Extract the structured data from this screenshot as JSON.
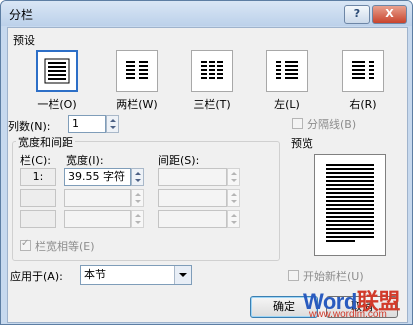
{
  "window": {
    "title": "分栏",
    "help_label": "?",
    "close_label": "X"
  },
  "presets": {
    "group_label": "预设",
    "items": [
      {
        "label": "一栏(O)",
        "columns": 1,
        "selected": true
      },
      {
        "label": "两栏(W)",
        "columns": 2,
        "selected": false
      },
      {
        "label": "三栏(T)",
        "columns": 3,
        "selected": false
      },
      {
        "label": "左(L)",
        "columns": "left",
        "selected": false
      },
      {
        "label": "右(R)",
        "columns": "right",
        "selected": false
      }
    ]
  },
  "columns_count": {
    "label": "列数(N):",
    "value": "1"
  },
  "divider": {
    "label": "分隔线(B)",
    "checked": false
  },
  "width_spacing": {
    "group_label": "宽度和间距",
    "col_header": "栏(C):",
    "width_header": "宽度(I):",
    "spacing_header": "间距(S):",
    "rows": [
      {
        "num": "1:",
        "width": "39.55 字符",
        "spacing": ""
      },
      {
        "num": "",
        "width": "",
        "spacing": ""
      },
      {
        "num": "",
        "width": "",
        "spacing": ""
      }
    ]
  },
  "equal_width": {
    "label": "栏宽相等(E)",
    "checked": true
  },
  "preview": {
    "label": "预览"
  },
  "apply_to": {
    "label": "应用于(A):",
    "value": "本节"
  },
  "new_column": {
    "label": "开始新栏(U)",
    "checked": false
  },
  "buttons": {
    "ok": "确定",
    "cancel": "取消"
  },
  "watermark": {
    "brand_word": "Word",
    "brand_cn": "联盟",
    "url": "www.wordlm.com",
    "word_color": "#2a5bbf",
    "cn_color": "#d23a2a"
  }
}
